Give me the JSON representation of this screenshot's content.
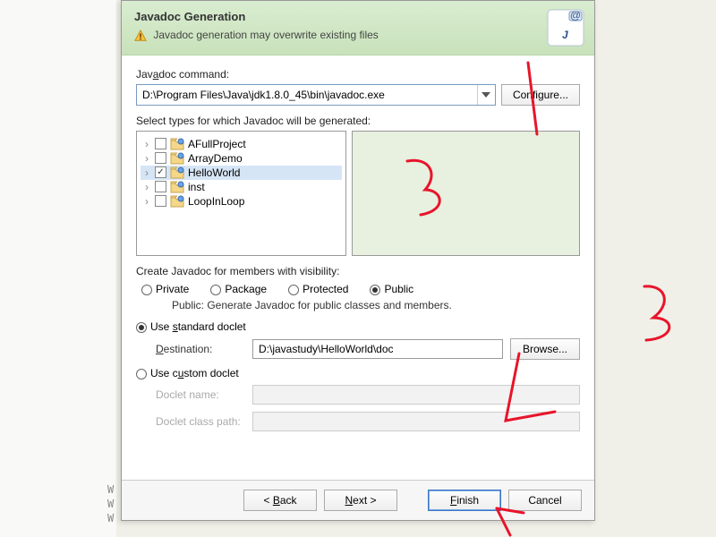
{
  "header": {
    "title": "Javadoc Generation",
    "warning": "Javadoc generation may overwrite existing files"
  },
  "command": {
    "label_pre": "Jav",
    "label_u": "a",
    "label_post": "doc command:",
    "value": "D:\\Program Files\\Java\\jdk1.8.0_45\\bin\\javadoc.exe",
    "configure": "Configure..."
  },
  "types": {
    "label": "Select types for which Javadoc will be generated:",
    "items": [
      {
        "name": "AFullProject",
        "checked": false,
        "selected": false
      },
      {
        "name": "ArrayDemo",
        "checked": false,
        "selected": false
      },
      {
        "name": "HelloWorld",
        "checked": true,
        "selected": true
      },
      {
        "name": "inst",
        "checked": false,
        "selected": false
      },
      {
        "name": "LoopInLoop",
        "checked": false,
        "selected": false
      }
    ]
  },
  "visibility": {
    "label": "Create Javadoc for members with visibility:",
    "options": {
      "private": "Private",
      "package": "Package",
      "protected": "Protected",
      "public": "Public"
    },
    "selected": "public",
    "desc": "Public: Generate Javadoc for public classes and members."
  },
  "doclet": {
    "standard": {
      "label_pre": "Use ",
      "label_u": "s",
      "label_post": "tandard doclet",
      "dest_pre": "",
      "dest_u": "D",
      "dest_post": "estination:",
      "dest_value": "D:\\javastudy\\HelloWorld\\doc",
      "browse": "Browse..."
    },
    "custom": {
      "label_pre": "Use c",
      "label_u": "u",
      "label_post": "stom doclet",
      "name_label": "Doclet name:",
      "path_label": "Doclet class path:"
    },
    "selected": "standard"
  },
  "footer": {
    "back_pre": "< ",
    "back_u": "B",
    "back_post": "ack",
    "next_pre": "",
    "next_u": "N",
    "next_post": "ext >",
    "finish_pre": "",
    "finish_u": "F",
    "finish_post": "inish",
    "cancel": "Cancel"
  },
  "annotations": {
    "a1": "1",
    "a2": "2",
    "a3": "3",
    "a4": "4"
  }
}
